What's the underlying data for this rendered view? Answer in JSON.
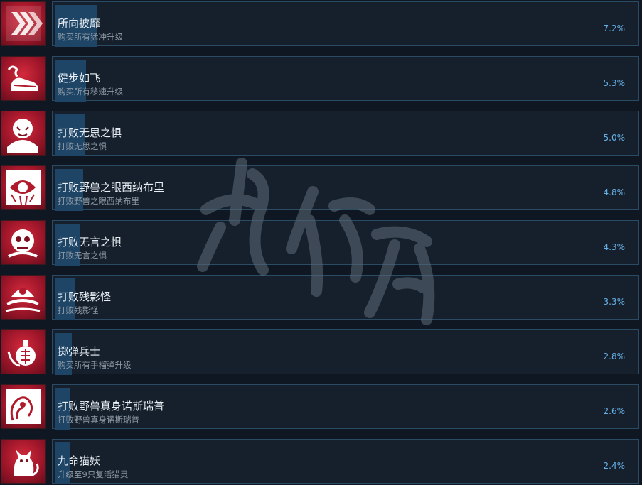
{
  "achievements": [
    {
      "title": "所向披靡",
      "desc": "购买所有猛冲升级",
      "percent": "7.2%",
      "progress": 0.072,
      "icon": "chevron-arrows-icon"
    },
    {
      "title": "健步如飞",
      "desc": "购买所有移速升级",
      "percent": "5.3%",
      "progress": 0.053,
      "icon": "winged-shoe-icon"
    },
    {
      "title": "打败无思之惧",
      "desc": "打败无思之惧",
      "percent": "5.0%",
      "progress": 0.05,
      "icon": "muscle-monster-icon"
    },
    {
      "title": "打败野兽之眼西纳布里",
      "desc": "打败野兽之眼西纳布里",
      "percent": "4.8%",
      "progress": 0.048,
      "icon": "beast-eye-icon"
    },
    {
      "title": "打败无言之惧",
      "desc": "打败无言之惧",
      "percent": "4.3%",
      "progress": 0.043,
      "icon": "skull-monster-icon"
    },
    {
      "title": "打败残影怪",
      "desc": "打败残影怪",
      "percent": "3.3%",
      "progress": 0.033,
      "icon": "afterimage-monster-icon"
    },
    {
      "title": "掷弹兵士",
      "desc": "购买所有手榴弹升级",
      "percent": "2.8%",
      "progress": 0.028,
      "icon": "grenade-icon"
    },
    {
      "title": "打败野兽真身诺斯瑞普",
      "desc": "打败野兽真身诺斯瑞普",
      "percent": "2.6%",
      "progress": 0.026,
      "icon": "tentacle-beast-icon"
    },
    {
      "title": "九命猫妖",
      "desc": "升级至9只复活猫灵",
      "percent": "2.4%",
      "progress": 0.024,
      "icon": "cat-icon"
    }
  ],
  "colors": {
    "background": "#0f1822",
    "card": "#16202d",
    "card_border": "#2b4a63",
    "progress": "#1f4566",
    "percent_text": "#67b0e6",
    "icon_red": "#c21f33"
  }
}
